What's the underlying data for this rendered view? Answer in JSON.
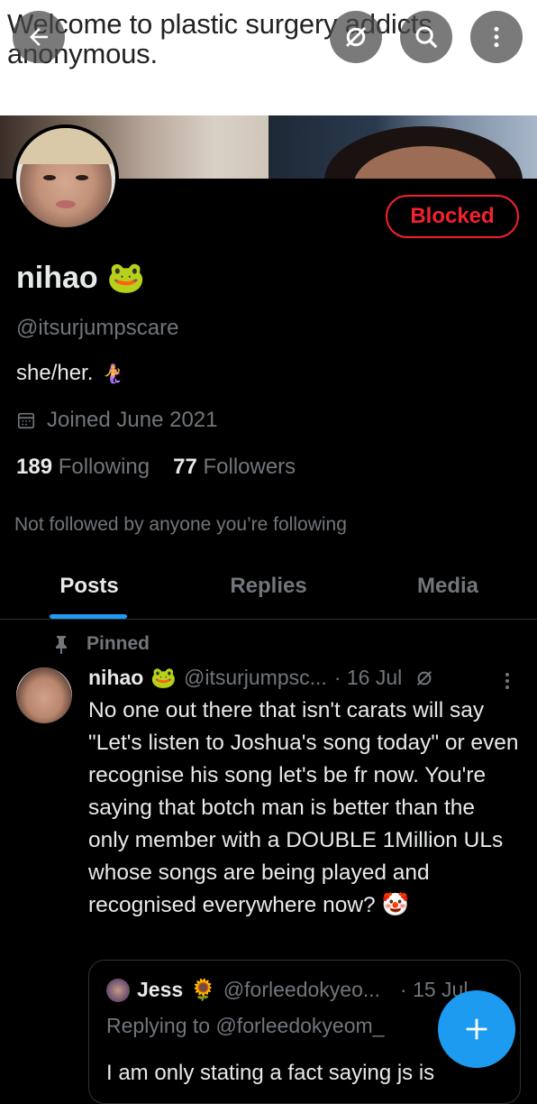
{
  "banner": {
    "text": "Welcome to plastic surgery addicts anonymous."
  },
  "toolbar": {
    "back_icon": "arrow-left-icon",
    "mute_icon": "no-signal-icon",
    "search_icon": "search-icon",
    "more_icon": "more-vertical-icon"
  },
  "profile": {
    "blocked_label": "Blocked",
    "name": "nihao",
    "name_emoji": "🐸",
    "handle": "@itsurjumpscare",
    "bio": "she/her.",
    "bio_emoji": "🧜‍♀️",
    "joined": "Joined June 2021",
    "following_count": "189",
    "following_label": "Following",
    "followers_count": "77",
    "followers_label": "Followers",
    "not_followed": "Not followed by anyone you’re following"
  },
  "tabs": [
    {
      "label": "Posts",
      "active": true
    },
    {
      "label": "Replies",
      "active": false
    },
    {
      "label": "Media",
      "active": false
    }
  ],
  "post": {
    "pinned_label": "Pinned",
    "author_name": "nihao",
    "author_emoji": "🐸",
    "author_handle": "@itsurjumpsc...",
    "date": "· 16 Jul",
    "text": "No one out there that isn't carats will say \"Let's listen to Joshua's song today\" or even recognise his song let's be fr now. You're saying that botch man is better than the only member with a DOUBLE 1Million ULs whose songs are being played and recognised everywhere now?",
    "text_emoji": "🤡"
  },
  "quote": {
    "author_name": "Jess",
    "author_emoji": "🌻",
    "author_handle": "@forleedokyeo...",
    "date": "· 15 Jul",
    "replying_to": "Replying to @forleedokyeom_",
    "text": "I am only stating a fact saying js is"
  },
  "fab": {
    "icon": "plus-icon"
  },
  "colors": {
    "accent": "#1d9bf0",
    "blocked": "#f4212e",
    "muted_text": "#71767b",
    "primary_text": "#e7e9ea",
    "background": "#000000"
  }
}
